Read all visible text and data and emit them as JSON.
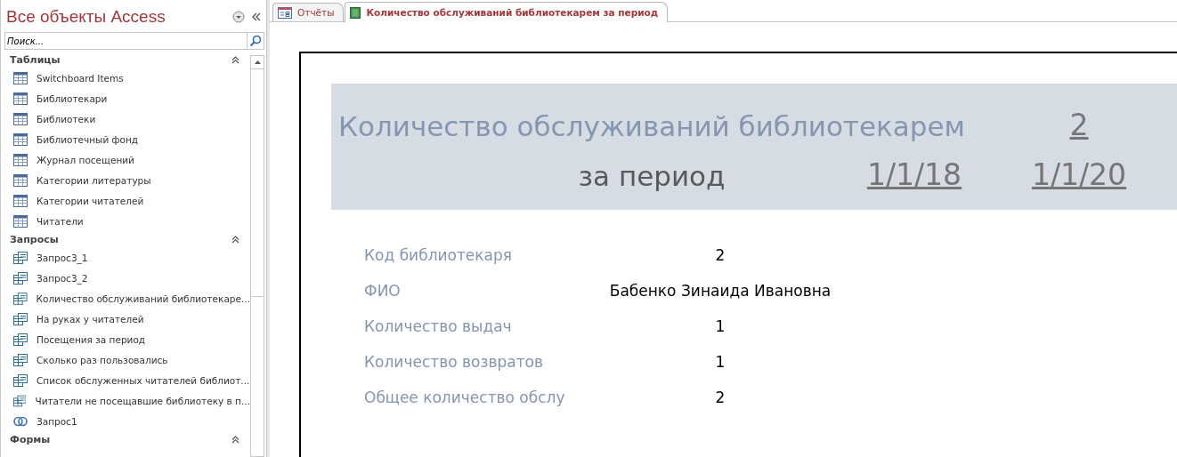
{
  "navigation_pane": {
    "title": "Все объекты Access",
    "search": {
      "placeholder": "Поиск..."
    },
    "groups": [
      {
        "name": "Таблицы",
        "expanded": true,
        "items": [
          {
            "label": "Switchboard Items",
            "kind": "table"
          },
          {
            "label": "Библиотекари",
            "kind": "table"
          },
          {
            "label": "Библиотеки",
            "kind": "table"
          },
          {
            "label": "Библиотечный фонд",
            "kind": "table"
          },
          {
            "label": "Журнал посещений",
            "kind": "table"
          },
          {
            "label": "Категории литературы",
            "kind": "table"
          },
          {
            "label": "Категории читателей",
            "kind": "table"
          },
          {
            "label": "Читатели",
            "kind": "table"
          }
        ]
      },
      {
        "name": "Запросы",
        "expanded": true,
        "items": [
          {
            "label": "Запрос3_1",
            "kind": "query"
          },
          {
            "label": "Запрос3_2",
            "kind": "query"
          },
          {
            "label": "Количество обслуживаний библиотекаре...",
            "kind": "query"
          },
          {
            "label": "На руках у читателей",
            "kind": "query"
          },
          {
            "label": "Посещения за период",
            "kind": "query"
          },
          {
            "label": "Сколько раз пользовались",
            "kind": "query"
          },
          {
            "label": "Список обслуженных читателей библиот...",
            "kind": "query"
          },
          {
            "label": "Читатели не посещавшие библиотеку в п...",
            "kind": "query"
          },
          {
            "label": "Запрос1",
            "kind": "union"
          }
        ]
      },
      {
        "name": "Формы",
        "expanded": true
      }
    ]
  },
  "tabs": [
    {
      "label": "Отчёты",
      "kind": "switchboard",
      "selected": false
    },
    {
      "label": "Количество обслуживаний библиотекарем за период",
      "kind": "report",
      "selected": true
    }
  ],
  "report": {
    "header": {
      "title": "Количество обслуживаний библиотекарем",
      "librarian_code": "2",
      "period_label": "за период",
      "date_from": "1/1/18",
      "date_to": "1/1/20"
    },
    "fields": [
      {
        "label": "Код библиотекаря",
        "value": "2"
      },
      {
        "label": "ФИО",
        "value": "Бабенко Зинаида Ивановна"
      },
      {
        "label": "Количество выдач",
        "value": "1"
      },
      {
        "label": "Количество возвратов",
        "value": "1"
      },
      {
        "label": "Общее количество обслу",
        "value": "2"
      }
    ]
  }
}
